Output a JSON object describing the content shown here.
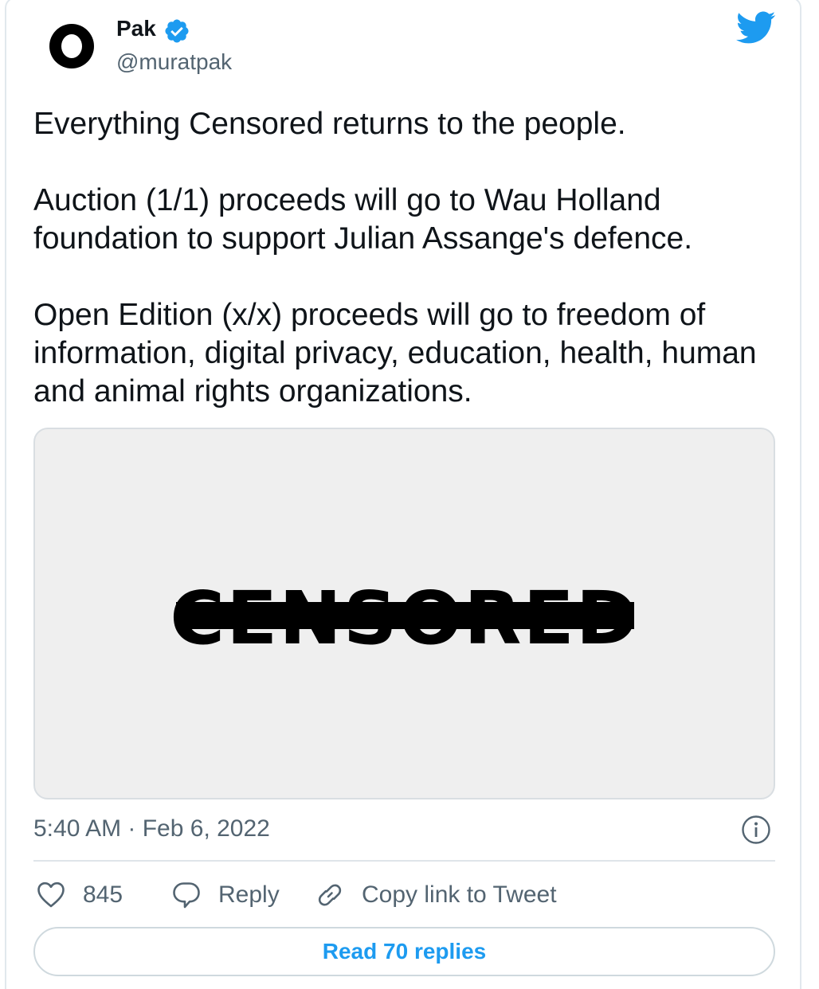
{
  "author": {
    "display_name": "Pak",
    "handle": "@muratpak",
    "verified": true,
    "avatar_icon": "avatar-icon"
  },
  "brand": {
    "icon": "twitter-bird-icon",
    "color": "#1d9bf0"
  },
  "tweet": {
    "paragraphs": [
      "Everything Censored returns to the people.",
      "Auction (1/1) proceeds will go to Wau Holland foundation to support Julian Assange's defence.",
      "Open Edition (x/x) proceeds will go to freedom of information, digital privacy, education, health, human and animal rights organizations."
    ],
    "media": {
      "artwork_text": "CENSORED",
      "background": "#efefef"
    },
    "timestamp": "5:40 AM · Feb 6, 2022"
  },
  "actions": {
    "like_count": "845",
    "reply_label": "Reply",
    "copy_link_label": "Copy link to Tweet"
  },
  "replies": {
    "button_label": "Read 70 replies"
  }
}
